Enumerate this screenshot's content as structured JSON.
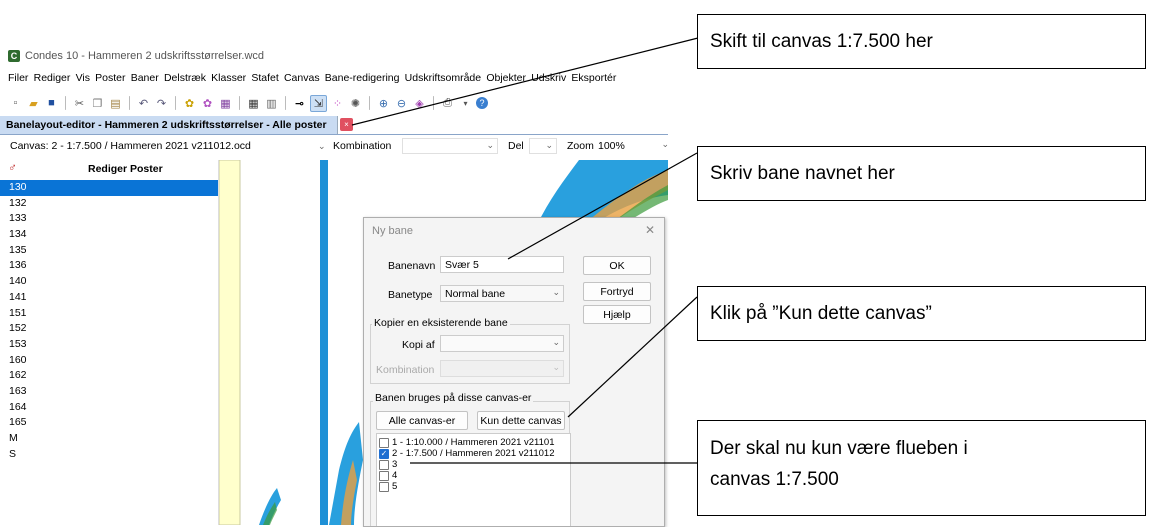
{
  "window": {
    "title": "Condes 10 - Hammeren 2 udskriftsstørrelser.wcd",
    "icon": "condes-app-icon"
  },
  "menu": [
    "Filer",
    "Rediger",
    "Vis",
    "Poster",
    "Baner",
    "Delstræk",
    "Klasser",
    "Stafet",
    "Canvas",
    "Bane-redigering",
    "Udskriftsområde",
    "Objekter",
    "Udskriv",
    "Eksportér"
  ],
  "toolbar_icons": [
    "new-file-icon",
    "open-folder-icon",
    "save-icon",
    "cut-icon",
    "copy-icon",
    "paste-icon",
    "undo-icon",
    "redo-icon",
    "star-icon",
    "star-purple-icon",
    "grid-icon",
    "table-icon",
    "lines-icon",
    "key-icon",
    "select-icon",
    "dots-icon",
    "spiral-icon",
    "zoom-in-icon",
    "zoom-out-icon",
    "zoom-fit-icon",
    "print-icon",
    "dropdown-icon",
    "help-icon"
  ],
  "tab": {
    "label": "Banelayout-editor - Hammeren 2 udskriftsstørrelser - Alle poster",
    "close": "×"
  },
  "canvasbar": {
    "canvas_label": "Canvas:",
    "canvas_value": "2 - 1:7.500 / Hammeren 2021 v211012.ocd",
    "kombination_label": "Kombination",
    "del_label": "Del",
    "zoom_label": "Zoom",
    "zoom_value": "100%"
  },
  "left_panel": {
    "header": "Rediger Poster",
    "items": [
      "130",
      "132",
      "133",
      "134",
      "135",
      "136",
      "140",
      "141",
      "151",
      "152",
      "153",
      "160",
      "162",
      "163",
      "164",
      "165",
      "M",
      "S"
    ],
    "selected_index": 0
  },
  "dialog": {
    "title": "Ny bane",
    "close": "✕",
    "banenavn_label": "Banenavn",
    "banenavn_value": "Svær 5",
    "banetype_label": "Banetype",
    "banetype_value": "Normal bane",
    "ok": "OK",
    "fortryd": "Fortryd",
    "hjaelp": "Hjælp",
    "kopier_group": "Kopier en eksisterende bane",
    "kopi_af_label": "Kopi af",
    "kombination_label": "Kombination",
    "canvas_group": "Banen bruges på disse canvas-er",
    "alle_btn": "Alle canvas-er",
    "kun_btn": "Kun dette canvas",
    "canvases": [
      {
        "label": "1 - 1:10.000 / Hammeren 2021 v21101",
        "checked": false
      },
      {
        "label": "2 - 1:7.500 / Hammeren 2021 v211012",
        "checked": true
      },
      {
        "label": "3",
        "checked": false
      },
      {
        "label": "4",
        "checked": false
      },
      {
        "label": "5",
        "checked": false
      }
    ]
  },
  "callouts": {
    "c1": "Skift til canvas 1:7.500 her",
    "c2": "Skriv bane navnet her",
    "c3": "Klik på ”Kun dette canvas”",
    "c4_line1": "Der skal nu kun være flueben i",
    "c4_line2": "canvas 1:7.500"
  },
  "colors": {
    "selection": "#0a74d6",
    "tab_bg": "#c9dbf2",
    "water": "#29a0de",
    "checkbox": "#1f6fd1",
    "vertical_rule": "#1e90d6",
    "panel_strip": "#ffffcc"
  }
}
